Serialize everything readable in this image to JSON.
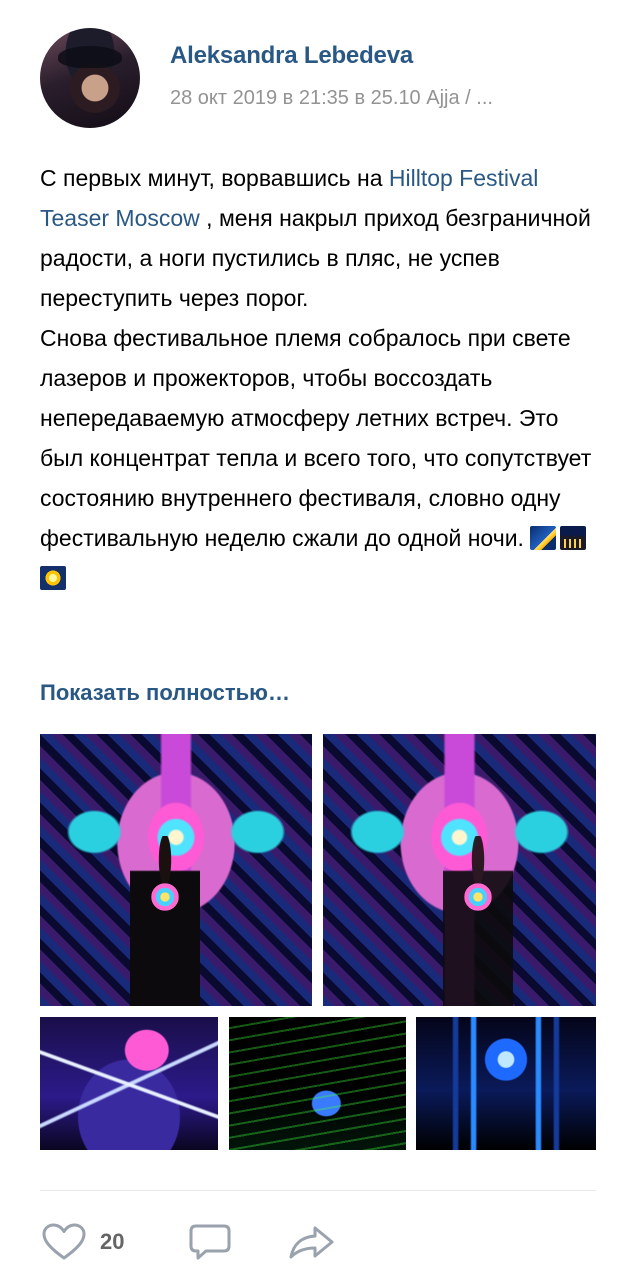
{
  "post": {
    "author": "Aleksandra Lebedeva",
    "meta": "28 окт 2019 в 21:35 в 25.10 Ajja / ...",
    "text": {
      "p1_before": "С первых минут, ворвавшись на ",
      "p1_link": "Hilltop Festival Teaser Moscow",
      "p1_after": " , меня накрыл приход безграничной радости, а ноги пустились в пляс, не успев переступить через порог.",
      "p2": "Снова фестивальное племя собралось при свете лазеров и прожекторов, чтобы воссоздать непередаваемую атмосферу летних встреч. Это был концентрат тепла и всего того, что сопутствует состоянию внутреннего фестиваля, словно одну фестивальную неделю сжали до одной ночи. "
    },
    "emojis": [
      "comet-emoji",
      "night-city-emoji",
      "sparkle-emoji"
    ],
    "show_more": "Показать полностью…",
    "photos": [
      "psychedelic-backdrop-photo",
      "psychedelic-backdrop-photo",
      "club-stage-lasers-photo",
      "green-lasers-photo",
      "blue-led-stage-photo"
    ],
    "likes": "20"
  },
  "icons": {
    "like": "heart-icon",
    "comment": "comment-bubble-icon",
    "share": "share-arrow-icon"
  },
  "colors": {
    "link": "#2a5885",
    "meta": "#939393",
    "icon": "#99a2ad",
    "divider": "#e7e8ec"
  }
}
